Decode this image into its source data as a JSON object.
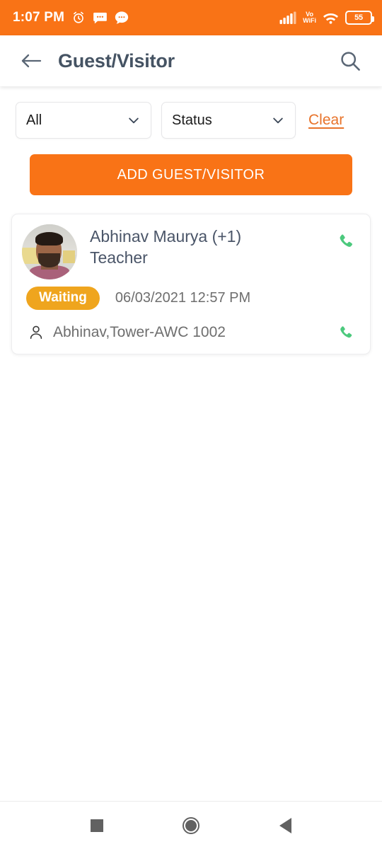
{
  "status_bar": {
    "time": "1:07 PM",
    "alarm_icon": "alarm-clock-icon",
    "message_icon": "message-box-icon",
    "chat_icon": "chat-bubble-icon",
    "signal_icon": "cellular-signal-icon",
    "vo_label": "Vo",
    "wifi_label": "WiFi",
    "wifi_icon": "wifi-icon",
    "battery_level": "55",
    "background_color": "#F97316"
  },
  "app_bar": {
    "back_icon": "back-arrow-icon",
    "title": "Guest/Visitor",
    "search_icon": "search-icon",
    "title_color": "#455363"
  },
  "filters": {
    "type_select": {
      "value": "All",
      "chevron_icon": "chevron-down-icon"
    },
    "status_select": {
      "value": "Status",
      "chevron_icon": "chevron-down-icon"
    },
    "clear_label": "Clear",
    "clear_color": "#E8732A"
  },
  "primary_action": {
    "label": "ADD GUEST/VISITOR",
    "color": "#F97316"
  },
  "guest_list": [
    {
      "avatar": "guest-avatar-photo",
      "name": "Abhinav Maurya (+1)",
      "role": "Teacher",
      "status_badge": "Waiting",
      "status_color": "#EFA51E",
      "datetime": "06/03/2021 12:57 PM",
      "host_icon": "person-icon",
      "host": "Abhinav,Tower-AWC 1002",
      "call_icon_top": "phone-call-icon",
      "call_icon_bottom": "phone-call-icon",
      "call_icon_color": "#4CC97D"
    }
  ],
  "nav_bar": {
    "recents_icon": "recents-square-icon",
    "home_icon": "home-circle-icon",
    "back_icon": "back-triangle-icon"
  }
}
